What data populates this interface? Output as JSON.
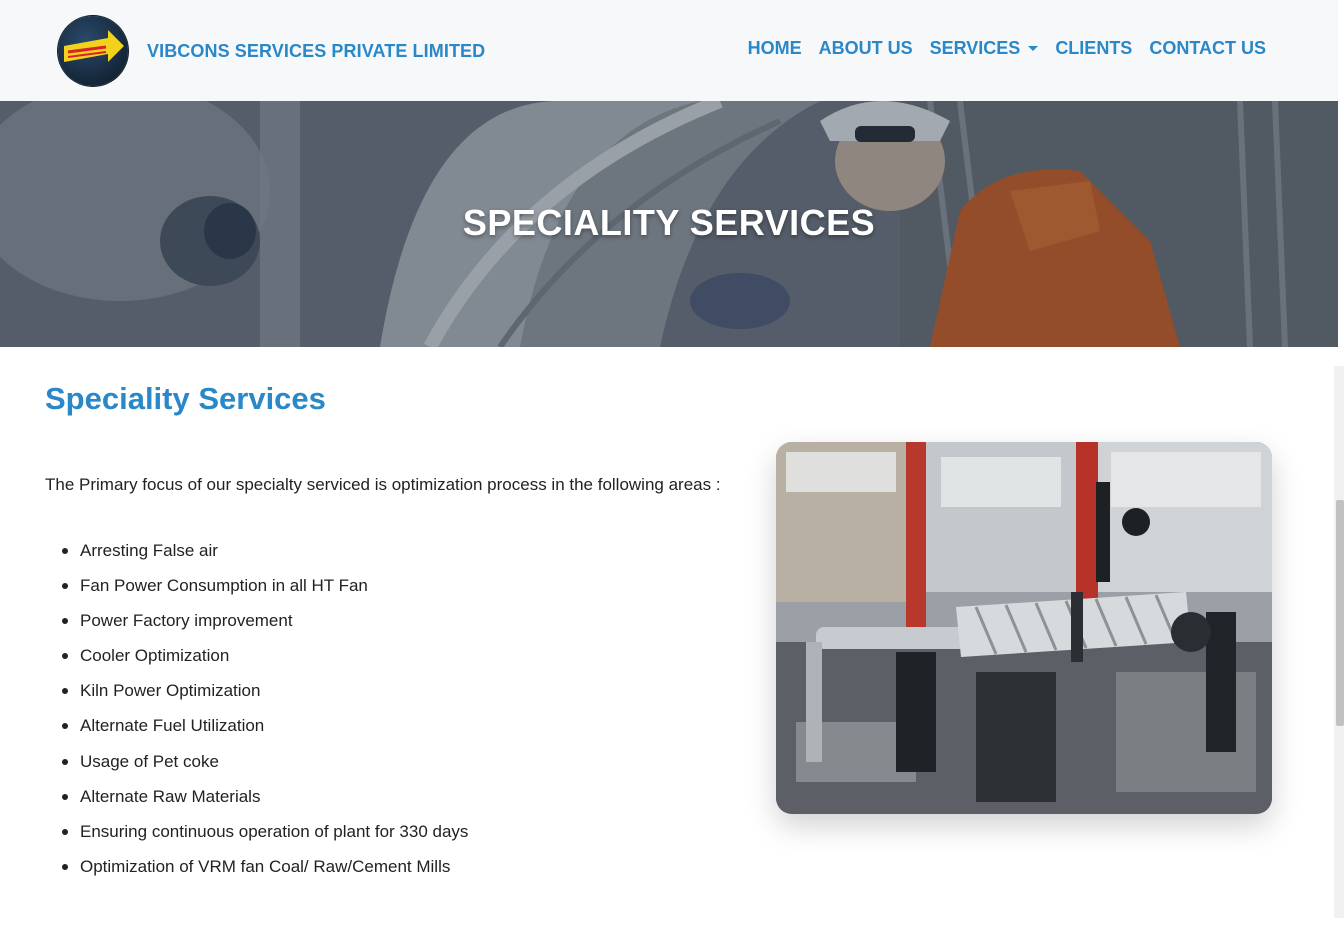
{
  "header": {
    "logo_icon": "company-logo-icon",
    "brand_name": "VIBCONS SERVICES PRIVATE LIMITED",
    "nav": {
      "home": "HOME",
      "about": "ABOUT US",
      "services": "SERVICES",
      "clients": "CLIENTS",
      "contact": "CONTACT US"
    }
  },
  "hero": {
    "title": "SPECIALITY SERVICES"
  },
  "content": {
    "section_title": "Speciality Services",
    "intro": "The Primary focus of our specialty serviced is optimization process in the following areas :",
    "items": [
      "Arresting False air",
      "Fan Power Consumption in all HT Fan",
      "Power Factory improvement",
      "Cooler Optimization",
      "Kiln Power Optimization",
      "Alternate Fuel Utilization",
      "Usage of Pet coke",
      "Alternate Raw Materials",
      "Ensuring continuous operation of plant for 330 days",
      "Optimization of VRM fan Coal/ Raw/Cement Mills"
    ]
  },
  "colors": {
    "accent": "#2a87c8",
    "navbar_bg": "#f7f8fa",
    "text": "#222222"
  }
}
